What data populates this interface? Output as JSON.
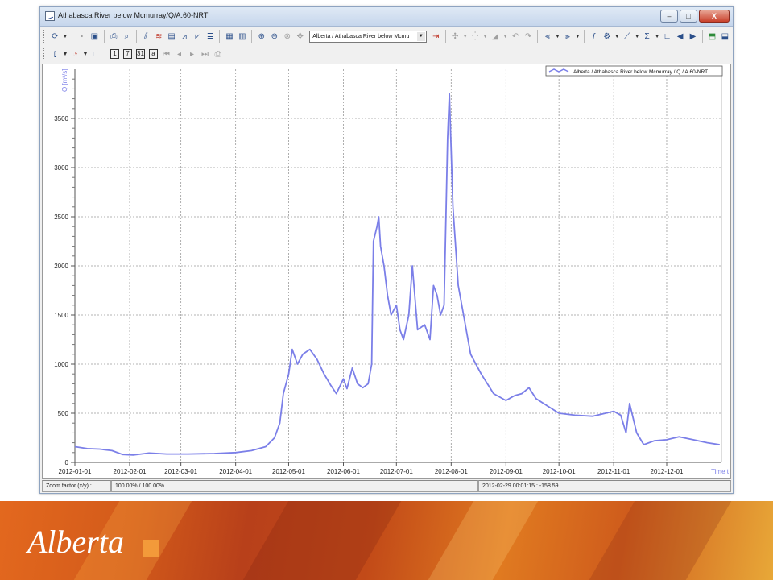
{
  "window": {
    "title": "Athabasca River below Mcmurray/Q/A.60-NRT",
    "min_label": "–",
    "max_label": "□",
    "close_label": "X"
  },
  "toolbar": {
    "station_combo": "Alberta / Athabasca River below Mcmu"
  },
  "statusbar": {
    "zoom_label": "Zoom factor (x/y) :",
    "zoom_value": "100.00% / 100.00%",
    "cursor_readout": "2012-02-29 00:01:15 : -158.59"
  },
  "brand": {
    "logo_text": "Alberta",
    "colors": {
      "orange": "#e3681e",
      "rust": "#b8401a",
      "gold": "#e8a838",
      "line": "#7b7fe8"
    }
  },
  "chart_data": {
    "type": "line",
    "ylabel": "Q [m³/s]",
    "xlabel": "Time t",
    "ylim": [
      0,
      4000
    ],
    "yticks": [
      0,
      500,
      1000,
      1500,
      2000,
      2500,
      3000,
      3500
    ],
    "xticks": [
      "2012-01-01",
      "2012-02-01",
      "2012-03-01",
      "2012-04-01",
      "2012-05-01",
      "2012-06-01",
      "2012-07-01",
      "2012-08-01",
      "2012-09-01",
      "2012-10-01",
      "2012-11-01",
      "2012-12-01"
    ],
    "xlim": [
      "2012-01-01",
      "2013-01-01"
    ],
    "grid": true,
    "legend_position": "top-right",
    "series": [
      {
        "name": "Alberta / Athabasca River below Mcmurray / Q / A.60-NRT",
        "color": "#7b7fe8",
        "points": [
          [
            "2012-01-01",
            160
          ],
          [
            "2012-01-08",
            140
          ],
          [
            "2012-01-15",
            135
          ],
          [
            "2012-01-22",
            120
          ],
          [
            "2012-01-28",
            80
          ],
          [
            "2012-02-03",
            75
          ],
          [
            "2012-02-12",
            95
          ],
          [
            "2012-02-22",
            85
          ],
          [
            "2012-03-05",
            85
          ],
          [
            "2012-03-20",
            90
          ],
          [
            "2012-04-01",
            100
          ],
          [
            "2012-04-10",
            120
          ],
          [
            "2012-04-18",
            160
          ],
          [
            "2012-04-23",
            250
          ],
          [
            "2012-04-26",
            400
          ],
          [
            "2012-04-28",
            700
          ],
          [
            "2012-05-01",
            900
          ],
          [
            "2012-05-03",
            1150
          ],
          [
            "2012-05-06",
            1000
          ],
          [
            "2012-05-09",
            1100
          ],
          [
            "2012-05-13",
            1150
          ],
          [
            "2012-05-17",
            1050
          ],
          [
            "2012-05-21",
            900
          ],
          [
            "2012-05-25",
            780
          ],
          [
            "2012-05-28",
            700
          ],
          [
            "2012-06-01",
            850
          ],
          [
            "2012-06-03",
            750
          ],
          [
            "2012-06-06",
            960
          ],
          [
            "2012-06-09",
            800
          ],
          [
            "2012-06-12",
            760
          ],
          [
            "2012-06-15",
            800
          ],
          [
            "2012-06-17",
            1000
          ],
          [
            "2012-06-18",
            2250
          ],
          [
            "2012-06-20",
            2400
          ],
          [
            "2012-06-21",
            2500
          ],
          [
            "2012-06-22",
            2200
          ],
          [
            "2012-06-24",
            2000
          ],
          [
            "2012-06-26",
            1700
          ],
          [
            "2012-06-28",
            1500
          ],
          [
            "2012-07-01",
            1600
          ],
          [
            "2012-07-03",
            1350
          ],
          [
            "2012-07-05",
            1250
          ],
          [
            "2012-07-08",
            1500
          ],
          [
            "2012-07-10",
            2000
          ],
          [
            "2012-07-13",
            1350
          ],
          [
            "2012-07-17",
            1400
          ],
          [
            "2012-07-20",
            1250
          ],
          [
            "2012-07-22",
            1800
          ],
          [
            "2012-07-24",
            1700
          ],
          [
            "2012-07-26",
            1500
          ],
          [
            "2012-07-28",
            1600
          ],
          [
            "2012-07-30",
            3300
          ],
          [
            "2012-07-31",
            3750
          ],
          [
            "2012-08-02",
            2600
          ],
          [
            "2012-08-05",
            1800
          ],
          [
            "2012-08-08",
            1500
          ],
          [
            "2012-08-12",
            1100
          ],
          [
            "2012-08-18",
            900
          ],
          [
            "2012-08-25",
            700
          ],
          [
            "2012-09-01",
            630
          ],
          [
            "2012-09-06",
            680
          ],
          [
            "2012-09-10",
            700
          ],
          [
            "2012-09-14",
            760
          ],
          [
            "2012-09-18",
            650
          ],
          [
            "2012-09-24",
            580
          ],
          [
            "2012-10-01",
            500
          ],
          [
            "2012-10-10",
            480
          ],
          [
            "2012-10-20",
            470
          ],
          [
            "2012-11-01",
            520
          ],
          [
            "2012-11-05",
            480
          ],
          [
            "2012-11-08",
            300
          ],
          [
            "2012-11-10",
            600
          ],
          [
            "2012-11-14",
            300
          ],
          [
            "2012-11-18",
            180
          ],
          [
            "2012-11-24",
            220
          ],
          [
            "2012-12-01",
            230
          ],
          [
            "2012-12-08",
            260
          ],
          [
            "2012-12-16",
            230
          ],
          [
            "2012-12-24",
            200
          ],
          [
            "2012-12-31",
            180
          ]
        ]
      }
    ]
  }
}
